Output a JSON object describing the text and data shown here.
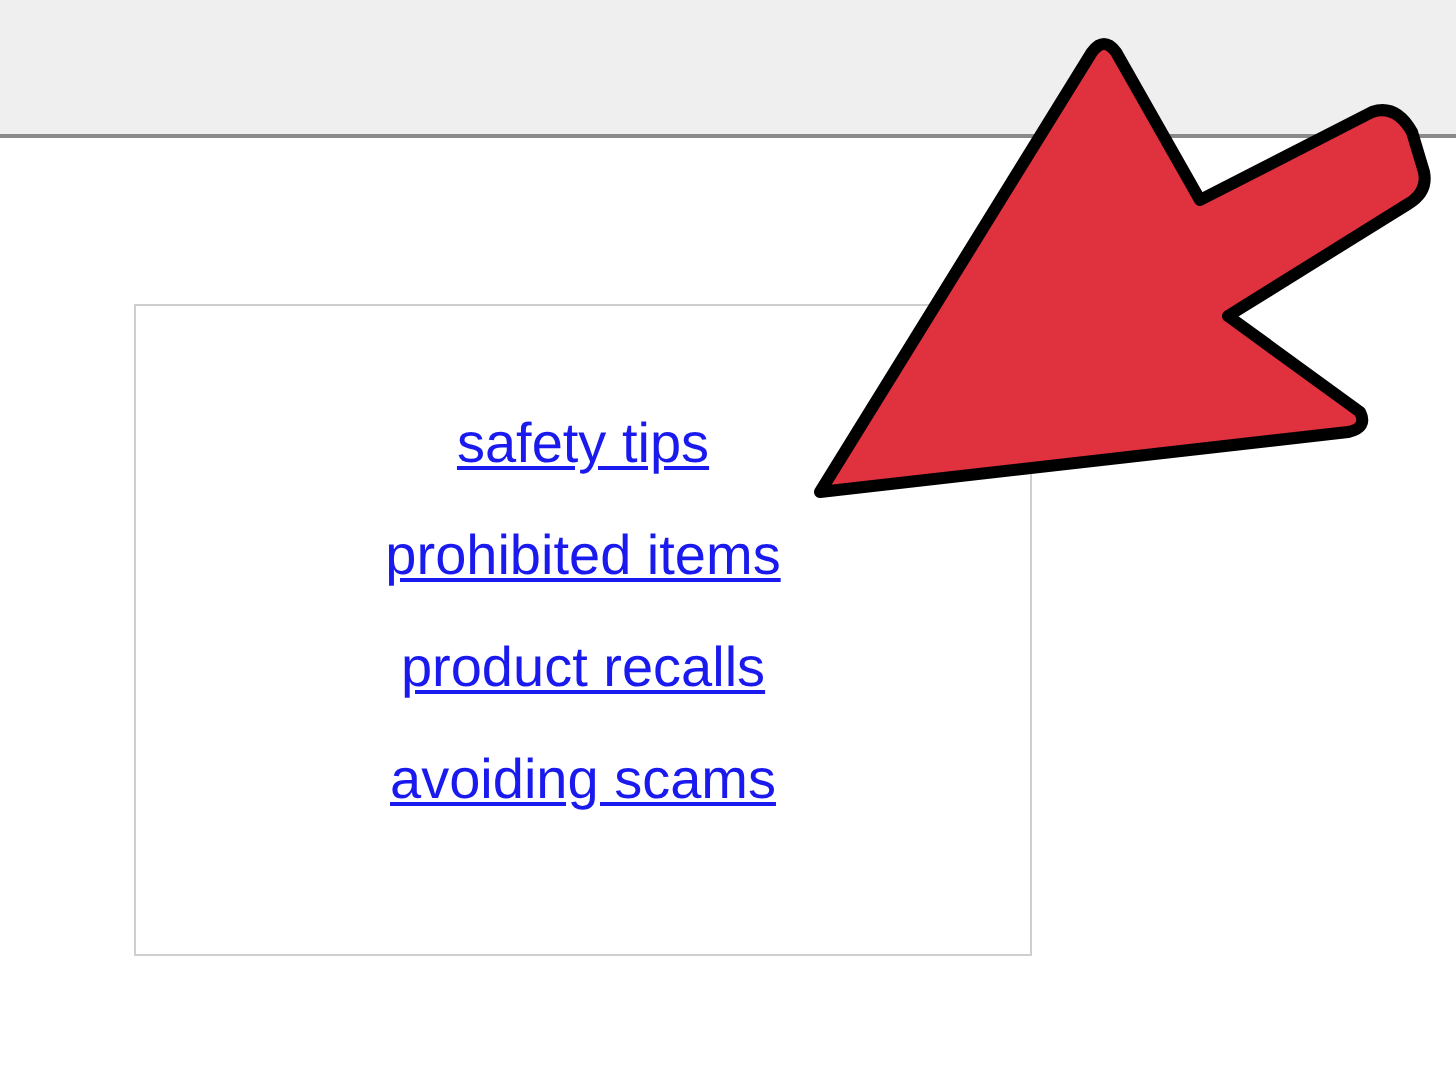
{
  "links": [
    {
      "label": "safety tips"
    },
    {
      "label": "prohibited items"
    },
    {
      "label": "product recalls"
    },
    {
      "label": "avoiding scams"
    }
  ]
}
